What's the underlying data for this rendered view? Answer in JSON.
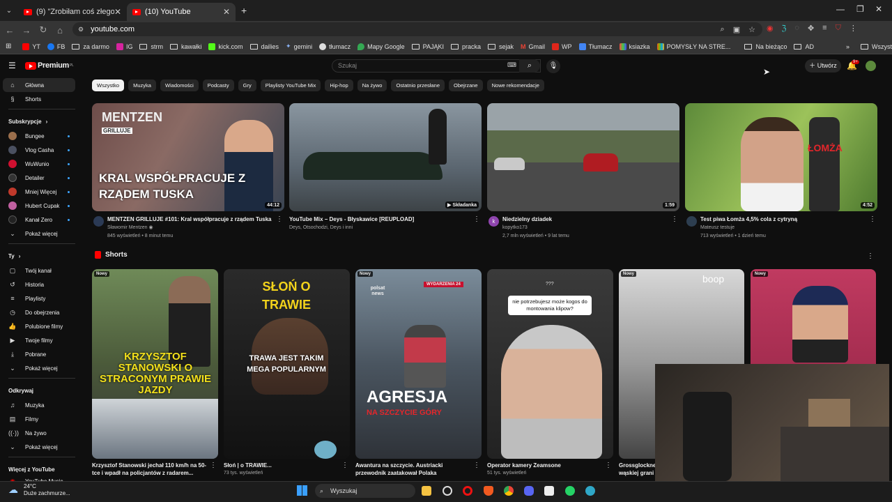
{
  "browser": {
    "tabs": [
      {
        "label": "(9) \"Zrobiłam coś złego dzieck..."
      },
      {
        "label": "(10) YouTube"
      }
    ],
    "new_tab": "+",
    "url": "youtube.com",
    "bookmarks": [
      "YT",
      "FB",
      "za darmo",
      "IG",
      "strm",
      "kawałki",
      "kick.com",
      "dailies",
      "gemini",
      "tłumacz",
      "Mapy Google",
      "PAJĄKI",
      "pracka",
      "sejak",
      "Gmail",
      "WP",
      "Tłumacz",
      "ksiazka",
      "POMYSŁY NA STRE...",
      "Na bieżąco",
      "AD"
    ],
    "all_bookmarks": "Wszystkie zakładki"
  },
  "youtube": {
    "logo": "Premium",
    "logo_sup": "PL",
    "search_placeholder": "Szukaj",
    "create_label": "Utwórz",
    "notif_count": "9+",
    "sidebar": {
      "main": [
        {
          "icon": "home-icon",
          "label": "Główna"
        },
        {
          "icon": "shorts-icon",
          "label": "Shorts"
        }
      ],
      "subs_header": "Subskrypcje",
      "subs": [
        {
          "label": "Bungee",
          "color": "#9b6f4c"
        },
        {
          "label": "Vlog Casha",
          "color": "#4a5060"
        },
        {
          "label": "WuWunio",
          "color": "#d01030"
        },
        {
          "label": "Detailer",
          "color": "#333333"
        },
        {
          "label": "Mniej Więcej",
          "color": "#c0392b"
        },
        {
          "label": "Hubert Cupak",
          "color": "#c060a0"
        },
        {
          "label": "Kanał Zero",
          "color": "#222222"
        }
      ],
      "show_more": "Pokaż więcej",
      "you_header": "Ty",
      "you": [
        {
          "icon": "channel-icon",
          "label": "Twój kanał"
        },
        {
          "icon": "history-icon",
          "label": "Historia"
        },
        {
          "icon": "playlist-icon",
          "label": "Playlisty"
        },
        {
          "icon": "watch-later-icon",
          "label": "Do obejrzenia"
        },
        {
          "icon": "like-icon",
          "label": "Polubione filmy"
        },
        {
          "icon": "video-icon",
          "label": "Twoje filmy"
        },
        {
          "icon": "download-icon",
          "label": "Pobrane"
        }
      ],
      "show_more2": "Pokaż więcej",
      "explore_header": "Odkrywaj",
      "explore": [
        {
          "icon": "music-icon",
          "label": "Muzyka"
        },
        {
          "icon": "film-icon",
          "label": "Filmy"
        },
        {
          "icon": "live-icon",
          "label": "Na żywo"
        }
      ],
      "show_more3": "Pokaż więcej",
      "more_header": "Więcej z YouTube",
      "more_item": "YouTube Music"
    },
    "chips": [
      "Wszystko",
      "Muzyka",
      "Wiadomości",
      "Podcasty",
      "Gry",
      "Playlisty YouTube Mix",
      "Hip-hop",
      "Na żywo",
      "Ostatnio przesłane",
      "Obejrzane",
      "Nowe rekomendacje"
    ],
    "videos": [
      {
        "title": "MENTZEN GRILLUJE #101: Kral współpracuje z rządem Tuska",
        "channel": "Sławomir Mentzen ◉",
        "stats": "845 wyświetleń • 8 minut temu",
        "duration": "44:12",
        "thumb_text": "KRAL WSPÓŁPRACUJE Z RZĄDEM TUSKA",
        "thumb_brand": "MENTZEN",
        "thumb_brand2": "GRILLUJE"
      },
      {
        "title": "YouTube Mix – Deys - Błyskawice [REUPLOAD]",
        "channel": "Deys, Otsochodzi, Deys i inni",
        "stats": "",
        "duration": "▶ Składanka"
      },
      {
        "title": "Niedzielny dziadek",
        "channel": "kopytko173",
        "stats": "2,7 mln wyświetleń • 9 lat temu",
        "duration": "1:59",
        "avatar_letter": "k"
      },
      {
        "title": "Test piwa Łomża 4,5% cola z cytryną",
        "channel": "Mateusz testuje",
        "stats": "713 wyświetleń • 1 dzień temu",
        "duration": "4:52",
        "thumb_text": "ŁOMŻA"
      }
    ],
    "shorts_header": "Shorts",
    "shorts": [
      {
        "badge": "Nowy",
        "title": "Krzysztof Stanowski jechał 110 km/h na 50-tce i wpadł na policjantów z radarem...",
        "stats": "",
        "overlay": "KRZYSZTOF STANOWSKI O STRACONYM PRAWIE JAZDY"
      },
      {
        "badge": "",
        "title": "Słoń | o TRAWIE...",
        "stats": "73 tys. wyświetleń",
        "overlay": "SŁOŃ O TRAWIE",
        "overlay2": "TRAWA JEST TAKIM MEGA POPULARNYM"
      },
      {
        "badge": "Nowy",
        "title": "Awantura na szczycie. Austriacki przewodnik zaatakował Polaka",
        "stats": "",
        "overlay": "AGRESJA",
        "overlay2": "NA SZCZYCIE GÓRY",
        "brand": "polsat news",
        "brand2": "WYDARZENIA 24"
      },
      {
        "badge": "",
        "title": "Operator kamery Zeamsone",
        "stats": "51 tys. wyświetleń",
        "overlay": "nie potrzebujesz może kogos do montowania klipow?",
        "overlay_small": "???"
      },
      {
        "badge": "Nowy",
        "title": "Grossglockner wąskiej grani",
        "stats": "",
        "brand": "boop"
      },
      {
        "badge": "Nowy",
        "title": "",
        "stats": ""
      }
    ]
  },
  "taskbar": {
    "temp": "24°C",
    "weather": "Duże zachmurze...",
    "search": "Wyszukaj"
  }
}
